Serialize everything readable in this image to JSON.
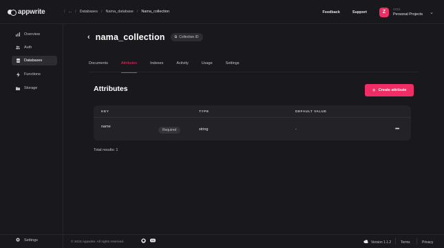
{
  "brand": {
    "name": "appwrite"
  },
  "breadcrumb": {
    "ellipsis": "...",
    "items": [
      "Databases",
      "Nama_database",
      "Nama_collection"
    ],
    "separator": "/"
  },
  "topbar": {
    "feedback": "Feedback",
    "support": "Support"
  },
  "account": {
    "initial": "Z",
    "user": "zzzu",
    "org": "Personal Projects"
  },
  "sidebar": {
    "items": [
      {
        "label": "Overview",
        "icon": "chart-icon"
      },
      {
        "label": "Auth",
        "icon": "users-icon"
      },
      {
        "label": "Databases",
        "icon": "database-icon",
        "active": true
      },
      {
        "label": "Functions",
        "icon": "lightning-icon"
      },
      {
        "label": "Storage",
        "icon": "folder-icon"
      }
    ],
    "settings": "Settings"
  },
  "collection": {
    "title": "nama_collection",
    "id_pill": "Collection ID"
  },
  "tabs": [
    "Documents",
    "Attributes",
    "Indexes",
    "Activity",
    "Usage",
    "Settings"
  ],
  "attributes": {
    "title": "Attributes",
    "create_label": "Create attribute",
    "columns": [
      "KEY",
      "TYPE",
      "DEFAULT VALUE"
    ],
    "rows": [
      {
        "key": "name",
        "badge": "Required",
        "type": "string",
        "default": "-"
      }
    ],
    "more_label": "•••"
  },
  "total": "Total results: 1",
  "footer": {
    "copyright": "© 2023 Appwrite. All rights reserved.",
    "version": "Version 1.1.2",
    "terms": "Terms",
    "privacy": "Privacy"
  },
  "colors": {
    "accent": "#f02e65",
    "bg": "#19191d",
    "card": "#232327"
  }
}
